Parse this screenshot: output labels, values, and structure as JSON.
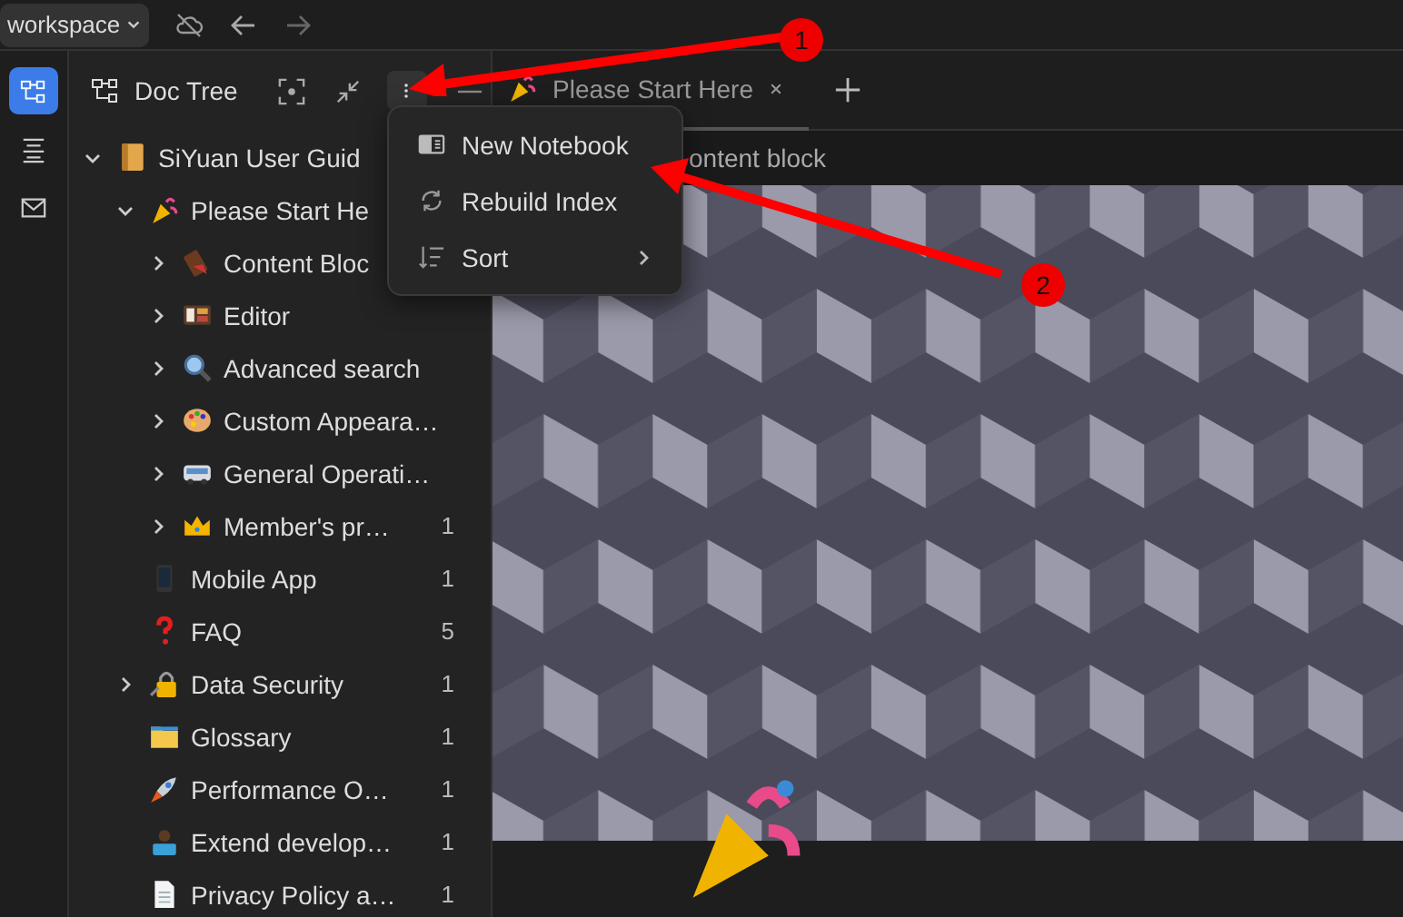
{
  "topbar": {
    "workspace": "workspace"
  },
  "dock": [
    {
      "kind": "tree",
      "selected": true
    },
    {
      "kind": "outline",
      "selected": false
    },
    {
      "kind": "inbox",
      "selected": false
    }
  ],
  "panel": {
    "title": "Doc Tree"
  },
  "tree": [
    {
      "label": "SiYuan User Guid",
      "kind": "notebook",
      "expanded": true,
      "children": [
        {
          "label": "Please Start He",
          "kind": "party",
          "expanded": true,
          "children": [
            {
              "label": "Content Bloc",
              "kind": "chocolate",
              "expanded": false
            },
            {
              "label": "Editor",
              "kind": "editor",
              "expanded": false
            },
            {
              "label": "Advanced search",
              "kind": "search",
              "expanded": false
            },
            {
              "label": "Custom Appeara…",
              "kind": "palette",
              "expanded": false
            },
            {
              "label": "General Operati…",
              "kind": "bus",
              "expanded": false
            },
            {
              "label": "Member's pr…",
              "kind": "crown",
              "expanded": false,
              "count": "1"
            }
          ]
        },
        {
          "label": "Mobile App",
          "kind": "phone",
          "count": "1"
        },
        {
          "label": "FAQ",
          "kind": "question",
          "count": "5"
        },
        {
          "label": "Data Security",
          "kind": "lock",
          "expanded": false,
          "count": "1"
        },
        {
          "label": "Glossary",
          "kind": "folder",
          "count": "1"
        },
        {
          "label": "Performance O…",
          "kind": "rocket",
          "count": "1"
        },
        {
          "label": "Extend develop…",
          "kind": "person",
          "count": "1"
        },
        {
          "label": "Privacy Policy a…",
          "kind": "document",
          "count": "1"
        }
      ]
    }
  ],
  "menu": [
    {
      "label": "New Notebook",
      "kind": "notebook",
      "submenu": false
    },
    {
      "label": "Rebuild Index",
      "kind": "rebuild",
      "submenu": false
    },
    {
      "label": "Sort",
      "kind": "sort",
      "submenu": true
    }
  ],
  "tabs": [
    {
      "label": "Please Start Here",
      "selected": true
    }
  ],
  "breadcrumb": "ontent block",
  "annotations": [
    {
      "label": "1"
    },
    {
      "label": "2"
    }
  ]
}
